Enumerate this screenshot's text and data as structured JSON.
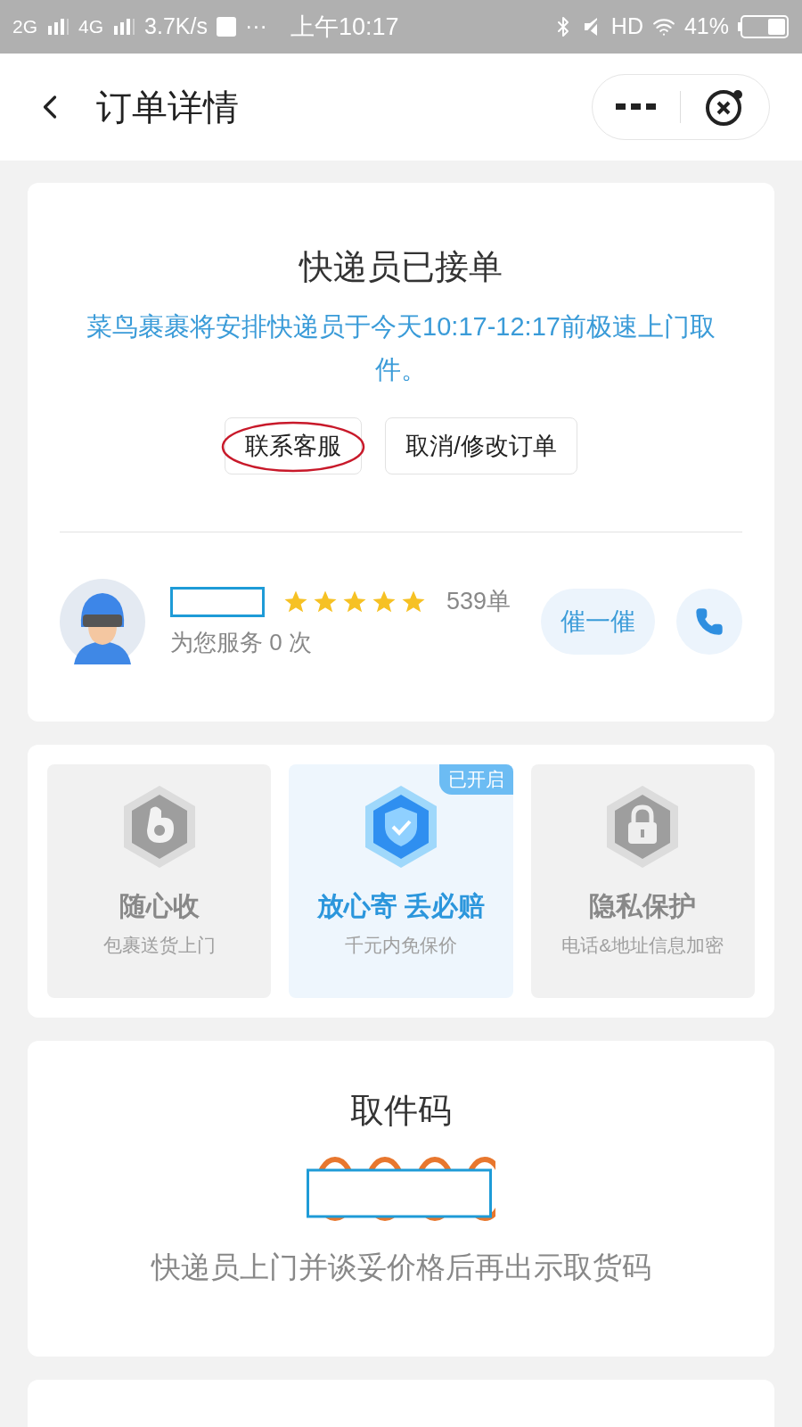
{
  "status_bar": {
    "network_1": "2G",
    "network_2": "4G",
    "speed": "3.7K/s",
    "more": "···",
    "time": "上午10:17",
    "hd": "HD",
    "battery": "41%"
  },
  "nav": {
    "title": "订单详情"
  },
  "order_status": {
    "title": "快递员已接单",
    "message": "菜鸟裹裹将安排快递员于今天10:17-12:17前极速上门取件。",
    "buttons": [
      {
        "label": "联系客服",
        "circled": true
      },
      {
        "label": "取消/修改订单",
        "circled": false
      }
    ]
  },
  "courier": {
    "stars": 5,
    "orders": "539单",
    "served": "为您服务 0 次",
    "urge_button": "催一催"
  },
  "features": [
    {
      "kind": "receive",
      "title": "随心收",
      "subtitle": "包裹送货上门",
      "on": false
    },
    {
      "kind": "insure",
      "title": "放心寄 丢必赔",
      "subtitle": "千元内免保价",
      "on": true,
      "badge": "已开启"
    },
    {
      "kind": "privacy",
      "title": "隐私保护",
      "subtitle": "电话&地址信息加密",
      "on": false
    }
  ],
  "pickup_code": {
    "title": "取件码",
    "note": "快递员上门并谈妥价格后再出示取货码"
  }
}
